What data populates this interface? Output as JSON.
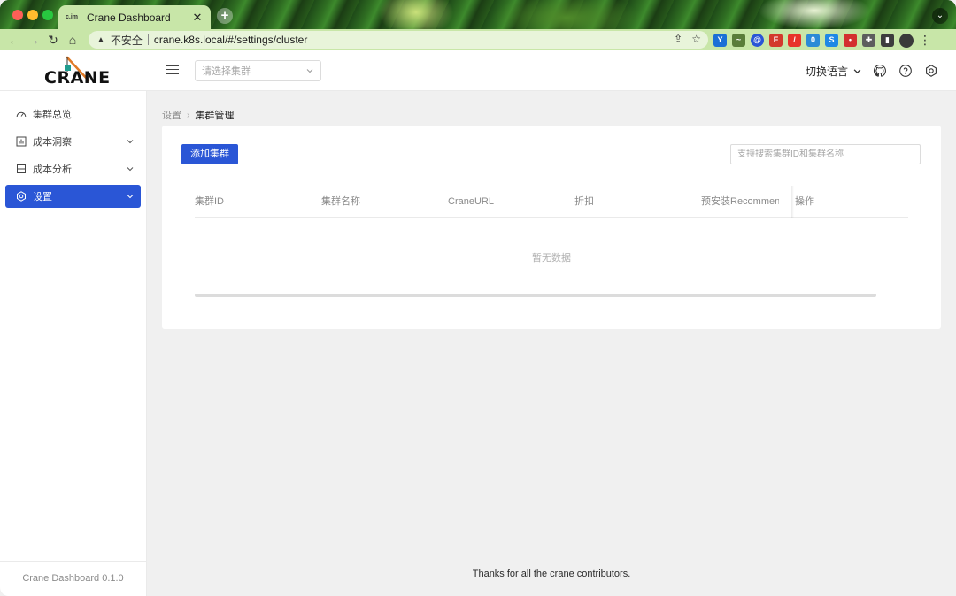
{
  "browser": {
    "tab_title": "Crane Dashboard",
    "tab_favicon_text": "c.im",
    "new_tab_symbol": "+",
    "security_label": "不安全",
    "url": "crane.k8s.local/#/settings/cluster"
  },
  "header": {
    "logo_text": "CRANE",
    "cluster_select_placeholder": "请选择集群",
    "language_label": "切换语言"
  },
  "sidebar": {
    "items": [
      {
        "label": "集群总览",
        "icon": "dashboard-icon",
        "expandable": false,
        "active": false
      },
      {
        "label": "成本洞察",
        "icon": "chart-bar-icon",
        "expandable": true,
        "active": false
      },
      {
        "label": "成本分析",
        "icon": "layout-icon",
        "expandable": true,
        "active": false
      },
      {
        "label": "设置",
        "icon": "setting-icon",
        "expandable": true,
        "active": true
      }
    ],
    "footer": "Crane Dashboard 0.1.0"
  },
  "breadcrumb": {
    "parent": "设置",
    "current": "集群管理"
  },
  "cluster_page": {
    "add_button_label": "添加集群",
    "search_placeholder": "支持搜索集群ID和集群名称",
    "columns": [
      "集群ID",
      "集群名称",
      "CraneURL",
      "折扣",
      "预安装Recommendation",
      "操作"
    ],
    "empty_text": "暂无数据"
  },
  "footer": {
    "text": "Thanks for all the crane contributors."
  },
  "colors": {
    "primary": "#2a56d6",
    "tab_bg": "#c8e6a8"
  }
}
